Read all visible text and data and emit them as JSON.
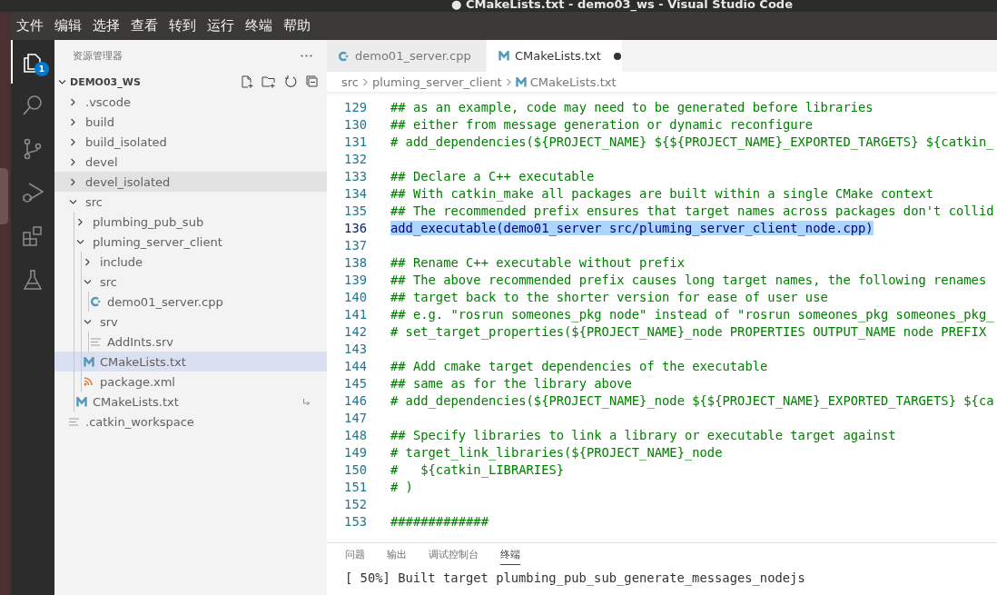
{
  "window": {
    "title": "● CMakeLists.txt - demo03_ws - Visual Studio Code"
  },
  "menu": [
    "文件",
    "编辑",
    "选择",
    "查看",
    "转到",
    "运行",
    "终端",
    "帮助"
  ],
  "activity_bar": [
    {
      "kind": "explorer",
      "selected": true,
      "badge": "1"
    },
    {
      "kind": "search",
      "selected": false
    },
    {
      "kind": "source-control",
      "selected": false
    },
    {
      "kind": "run-debug",
      "selected": false
    },
    {
      "kind": "extensions",
      "selected": false
    },
    {
      "kind": "flask",
      "selected": false
    }
  ],
  "explorer": {
    "title": "资源管理器",
    "root": {
      "label": "DEMO03_WS",
      "expanded": true,
      "children": [
        {
          "label": ".vscode",
          "kind": "folder",
          "expanded": false,
          "selected": false,
          "hovered": false
        },
        {
          "label": "build",
          "kind": "folder",
          "expanded": false,
          "selected": false,
          "hovered": false
        },
        {
          "label": "build_isolated",
          "kind": "folder",
          "expanded": false,
          "selected": false,
          "hovered": false
        },
        {
          "label": "devel",
          "kind": "folder",
          "expanded": false,
          "selected": false,
          "hovered": false
        },
        {
          "label": "devel_isolated",
          "kind": "folder",
          "expanded": false,
          "selected": false,
          "hovered": true
        },
        {
          "label": "src",
          "kind": "folder",
          "expanded": true,
          "selected": false,
          "hovered": false,
          "children": [
            {
              "label": "plumbing_pub_sub",
              "kind": "folder",
              "expanded": false,
              "selected": false,
              "hovered": false
            },
            {
              "label": "pluming_server_client",
              "kind": "folder",
              "expanded": true,
              "selected": false,
              "hovered": false,
              "children": [
                {
                  "label": "include",
                  "kind": "folder",
                  "expanded": false,
                  "selected": false,
                  "hovered": false
                },
                {
                  "label": "src",
                  "kind": "folder",
                  "expanded": true,
                  "selected": false,
                  "hovered": false,
                  "children": [
                    {
                      "label": "demo01_server.cpp",
                      "kind": "cpp",
                      "selected": false,
                      "hovered": false
                    }
                  ]
                },
                {
                  "label": "srv",
                  "kind": "folder",
                  "expanded": true,
                  "selected": false,
                  "hovered": false,
                  "children": [
                    {
                      "label": "AddInts.srv",
                      "kind": "text",
                      "selected": false,
                      "hovered": false
                    }
                  ]
                },
                {
                  "label": "CMakeLists.txt",
                  "kind": "cmake",
                  "selected": true,
                  "hovered": false
                },
                {
                  "label": "package.xml",
                  "kind": "xml",
                  "selected": false,
                  "hovered": false
                }
              ]
            },
            {
              "label": "CMakeLists.txt",
              "kind": "cmake",
              "selected": false,
              "hovered": false,
              "symlink": true
            }
          ]
        },
        {
          "label": ".catkin_workspace",
          "kind": "text",
          "selected": false,
          "hovered": false
        }
      ]
    }
  },
  "tabs": [
    {
      "label": "demo01_server.cpp",
      "kind": "cpp",
      "selected": false,
      "modified": false
    },
    {
      "label": "CMakeLists.txt",
      "kind": "cmake",
      "selected": true,
      "modified": true
    }
  ],
  "breadcrumbs": [
    {
      "label": "src",
      "kind": "folder"
    },
    {
      "label": "pluming_server_client",
      "kind": "folder"
    },
    {
      "label": "CMakeLists.txt",
      "kind": "cmake"
    }
  ],
  "code_lines": [
    {
      "number": "129",
      "kind": "comment",
      "text": "## as an example, code may need to be generated before libraries",
      "selected": false
    },
    {
      "number": "130",
      "kind": "comment",
      "text": "## either from message generation or dynamic reconfigure",
      "selected": false
    },
    {
      "number": "131",
      "kind": "comment",
      "text": "# add_dependencies(${PROJECT_NAME} ${${PROJECT_NAME}_EXPORTED_TARGETS} ${catkin_",
      "selected": false
    },
    {
      "number": "132",
      "selected": false
    },
    {
      "number": "133",
      "kind": "comment",
      "text": "## Declare a C++ executable",
      "selected": false
    },
    {
      "number": "134",
      "kind": "comment",
      "text": "## With catkin_make all packages are built within a single CMake context",
      "selected": false
    },
    {
      "number": "135",
      "kind": "comment",
      "text": "## The recommended prefix ensures that target names across packages don't collid",
      "selected": false
    },
    {
      "number": "136",
      "kind": "code",
      "text": "add_executable(demo01_server src/pluming_server_client_node.cpp)",
      "selected": true
    },
    {
      "number": "137",
      "selected": false
    },
    {
      "number": "138",
      "kind": "comment",
      "text": "## Rename C++ executable without prefix",
      "selected": false
    },
    {
      "number": "139",
      "kind": "comment",
      "text": "## The above recommended prefix causes long target names, the following renames",
      "selected": false
    },
    {
      "number": "140",
      "kind": "comment",
      "text": "## target back to the shorter version for ease of user use",
      "selected": false
    },
    {
      "number": "141",
      "kind": "comment",
      "text": "## e.g. \"rosrun someones_pkg node\" instead of \"rosrun someones_pkg someones_pkg_",
      "selected": false
    },
    {
      "number": "142",
      "kind": "comment",
      "text": "# set_target_properties(${PROJECT_NAME}_node PROPERTIES OUTPUT_NAME node PREFIX",
      "selected": false
    },
    {
      "number": "143",
      "selected": false
    },
    {
      "number": "144",
      "kind": "comment",
      "text": "## Add cmake target dependencies of the executable",
      "selected": false
    },
    {
      "number": "145",
      "kind": "comment",
      "text": "## same as for the library above",
      "selected": false
    },
    {
      "number": "146",
      "kind": "comment",
      "text": "# add_dependencies(${PROJECT_NAME}_node ${${PROJECT_NAME}_EXPORTED_TARGETS} ${ca",
      "selected": false
    },
    {
      "number": "147",
      "selected": false
    },
    {
      "number": "148",
      "kind": "comment",
      "text": "## Specify libraries to link a library or executable target against",
      "selected": false
    },
    {
      "number": "149",
      "kind": "comment",
      "text": "# target_link_libraries(${PROJECT_NAME}_node",
      "selected": false
    },
    {
      "number": "150",
      "kind": "comment",
      "text": "#   ${catkin_LIBRARIES}",
      "selected": false
    },
    {
      "number": "151",
      "kind": "comment",
      "text": "# )",
      "selected": false
    },
    {
      "number": "152",
      "selected": false
    },
    {
      "number": "153",
      "kind": "comment",
      "text": "#############",
      "selected": false
    }
  ],
  "panel": {
    "tabs": [
      {
        "label": "问题",
        "selected": false
      },
      {
        "label": "输出",
        "selected": false
      },
      {
        "label": "调试控制台",
        "selected": false
      },
      {
        "label": "终端",
        "selected": true
      }
    ],
    "terminal_lines": [
      "[ 50%] Built target plumbing_pub_sub_generate_messages_nodejs"
    ]
  }
}
